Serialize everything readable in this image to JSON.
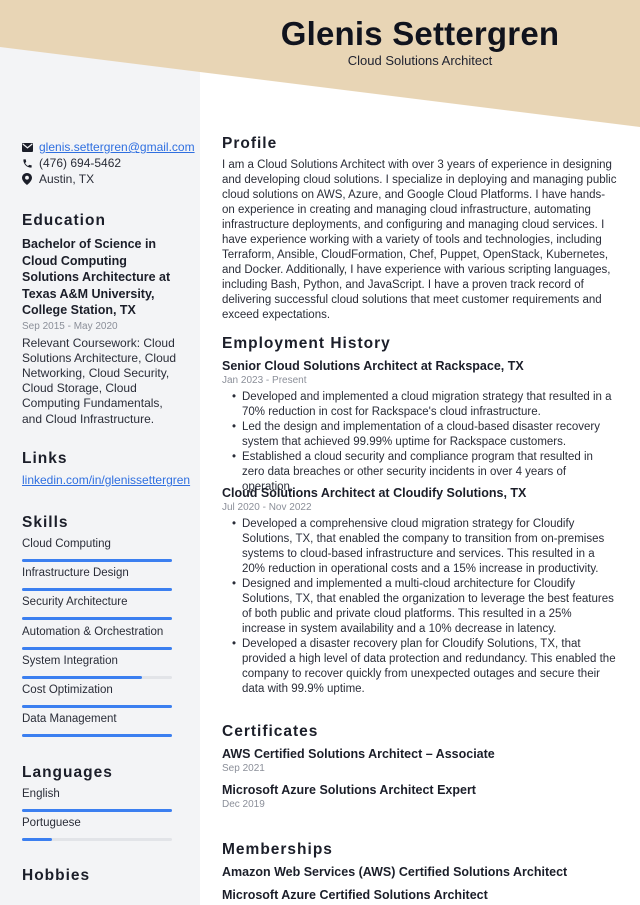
{
  "header": {
    "name": "Glenis Settergren",
    "role": "Cloud Solutions Architect",
    "banner_color": "#e8d5b5"
  },
  "contact": {
    "email": "glenis.settergren@gmail.com",
    "phone": "(476) 694-5462",
    "location": "Austin, TX",
    "icons": [
      "envelope-icon",
      "phone-icon",
      "map-pin-icon"
    ]
  },
  "education": {
    "heading": "Education",
    "degree": "Bachelor of Science in Cloud Computing Solutions Architecture at Texas A&M University, College Station, TX",
    "dates": "Sep 2015 - May 2020",
    "description": "Relevant Coursework: Cloud Solutions Architecture, Cloud Networking, Cloud Security, Cloud Storage, Cloud Computing Fundamentals, and Cloud Infrastructure."
  },
  "links": {
    "heading": "Links",
    "items": [
      "linkedin.com/in/glenissettergren"
    ]
  },
  "skills": {
    "heading": "Skills",
    "accent": "#3b7ff0",
    "items": [
      {
        "label": "Cloud Computing",
        "level": 100
      },
      {
        "label": "Infrastructure Design",
        "level": 100
      },
      {
        "label": "Security Architecture",
        "level": 100
      },
      {
        "label": "Automation & Orchestration",
        "level": 100
      },
      {
        "label": "System Integration",
        "level": 80
      },
      {
        "label": "Cost Optimization",
        "level": 100
      },
      {
        "label": "Data Management",
        "level": 100
      }
    ]
  },
  "languages": {
    "heading": "Languages",
    "items": [
      {
        "label": "English",
        "level": 100
      },
      {
        "label": "Portuguese",
        "level": 20
      }
    ]
  },
  "hobbies": {
    "heading": "Hobbies"
  },
  "profile": {
    "heading": "Profile",
    "text": "I am a Cloud Solutions Architect with over 3 years of experience in designing and developing cloud solutions. I specialize in deploying and managing public cloud solutions on AWS, Azure, and Google Cloud Platforms. I have hands-on experience in creating and managing cloud infrastructure, automating infrastructure deployments, and configuring and managing cloud services. I have experience working with a variety of tools and technologies, including Terraform, Ansible, CloudFormation, Chef, Puppet, OpenStack, Kubernetes, and Docker. Additionally, I have experience with various scripting languages, including Bash, Python, and JavaScript. I have a proven track record of delivering successful cloud solutions that meet customer requirements and exceed expectations."
  },
  "employment": {
    "heading": "Employment History",
    "jobs": [
      {
        "title": "Senior Cloud Solutions Architect at Rackspace, TX",
        "dates": "Jan 2023 - Present",
        "bullets": [
          "Developed and implemented a cloud migration strategy that resulted in a 70% reduction in cost for Rackspace's cloud infrastructure.",
          "Led the design and implementation of a cloud-based disaster recovery system that achieved 99.99% uptime for Rackspace customers.",
          "Established a cloud security and compliance program that resulted in zero data breaches or other security incidents in over 4 years of operation."
        ]
      },
      {
        "title": "Cloud Solutions Architect at Cloudify Solutions, TX",
        "dates": "Jul 2020 - Nov 2022",
        "bullets": [
          "Developed a comprehensive cloud migration strategy for Cloudify Solutions, TX, that enabled the company to transition from on-premises systems to cloud-based infrastructure and services. This resulted in a 20% reduction in operational costs and a 15% increase in productivity.",
          "Designed and implemented a multi-cloud architecture for Cloudify Solutions, TX, that enabled the organization to leverage the best features of both public and private cloud platforms. This resulted in a 25% increase in system availability and a 10% decrease in latency.",
          "Developed a disaster recovery plan for Cloudify Solutions, TX, that provided a high level of data protection and redundancy. This enabled the company to recover quickly from unexpected outages and secure their data with 99.9% uptime."
        ]
      }
    ]
  },
  "certificates": {
    "heading": "Certificates",
    "items": [
      {
        "title": "AWS Certified Solutions Architect – Associate",
        "date": "Sep 2021"
      },
      {
        "title": "Microsoft Azure Solutions Architect Expert",
        "date": "Dec 2019"
      }
    ]
  },
  "memberships": {
    "heading": "Memberships",
    "items": [
      "Amazon Web Services (AWS) Certified Solutions Architect",
      "Microsoft Azure Certified Solutions Architect"
    ]
  }
}
